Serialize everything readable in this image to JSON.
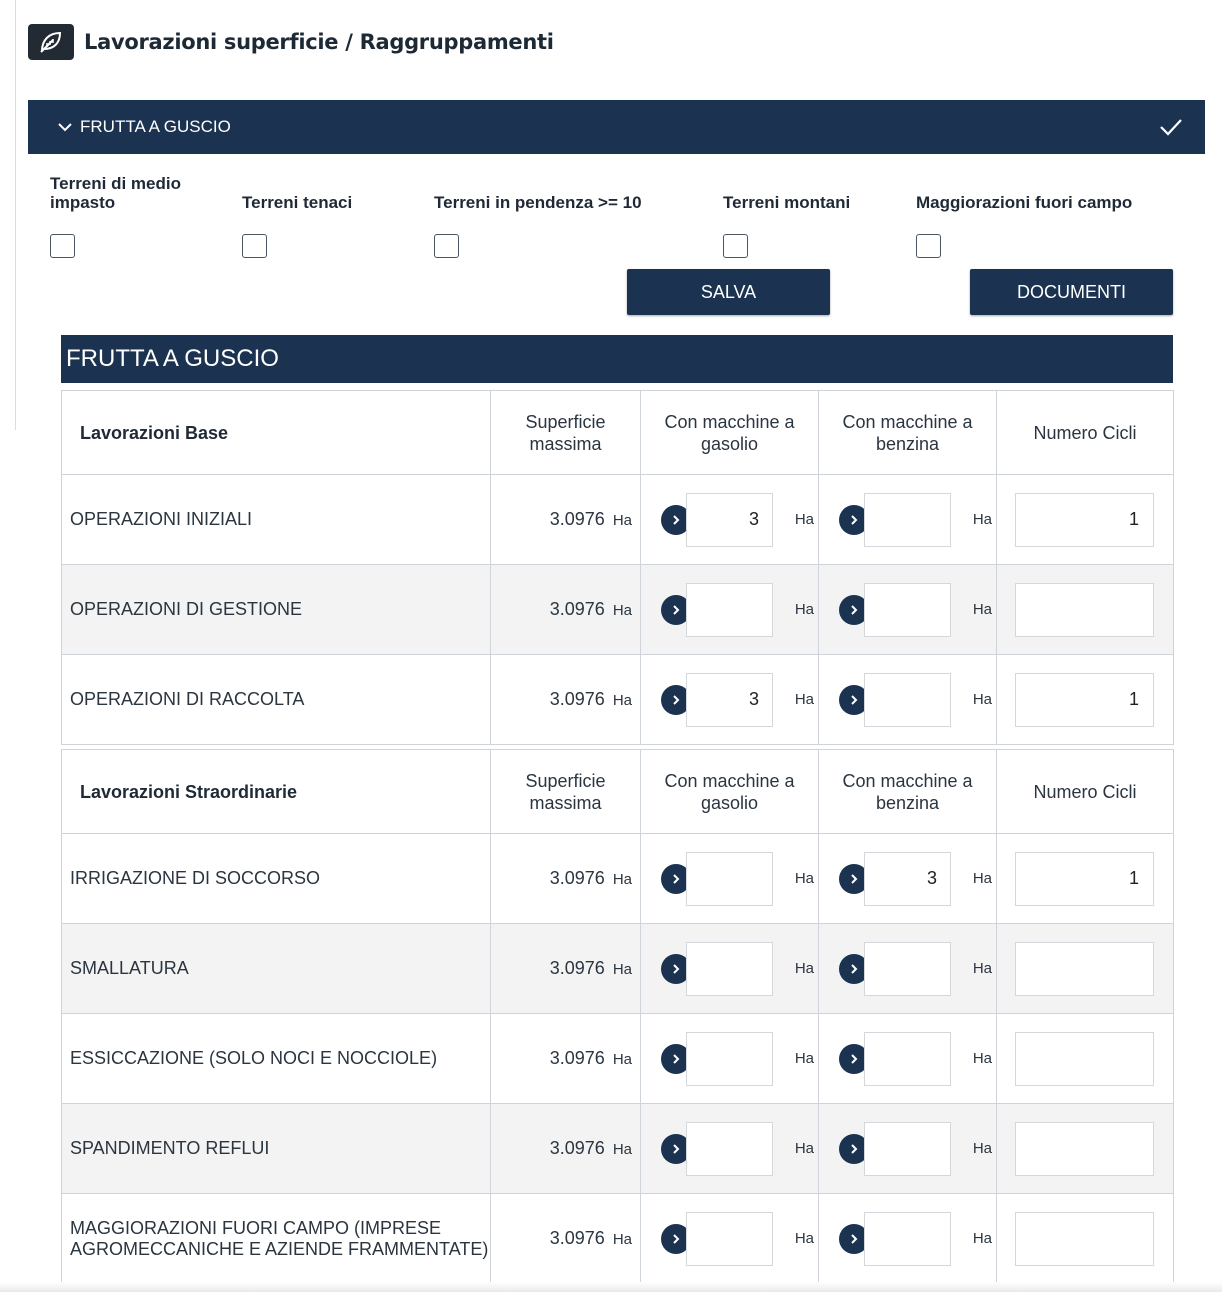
{
  "header": {
    "title": "Lavorazioni superficie / Raggruppamenti",
    "icon": "leaf-icon"
  },
  "accordion": {
    "label": "FRUTTA A GUSCIO",
    "expanded": true,
    "completed": true
  },
  "options": [
    {
      "label": "Terreni di medio impasto",
      "checked": false
    },
    {
      "label": "Terreni tenaci",
      "checked": false
    },
    {
      "label": "Terreni in pendenza >= 10",
      "checked": false
    },
    {
      "label": "Terreni montani",
      "checked": false
    },
    {
      "label": "Maggiorazioni fuori campo",
      "checked": false
    }
  ],
  "buttons": {
    "save": "SALVA",
    "documents": "DOCUMENTI"
  },
  "section": {
    "title": "FRUTTA A GUSCIO"
  },
  "columns": {
    "superficie": "Superficie massima",
    "gasolio": "Con macchine a gasolio",
    "benzina": "Con macchine a benzina",
    "cicli": "Numero Cicli",
    "unit": "Ha"
  },
  "base": {
    "title": "Lavorazioni Base",
    "rows": [
      {
        "name": "OPERAZIONI INIZIALI",
        "superficie": "3.0976",
        "gasolio": "3",
        "benzina": "",
        "cicli": "1"
      },
      {
        "name": "OPERAZIONI DI GESTIONE",
        "superficie": "3.0976",
        "gasolio": "",
        "benzina": "",
        "cicli": ""
      },
      {
        "name": "OPERAZIONI DI RACCOLTA",
        "superficie": "3.0976",
        "gasolio": "3",
        "benzina": "",
        "cicli": "1"
      }
    ]
  },
  "straordinarie": {
    "title": "Lavorazioni Straordinarie",
    "rows": [
      {
        "name": "IRRIGAZIONE DI SOCCORSO",
        "superficie": "3.0976",
        "gasolio": "",
        "benzina": "3",
        "cicli": "1"
      },
      {
        "name": "SMALLATURA",
        "superficie": "3.0976",
        "gasolio": "",
        "benzina": "",
        "cicli": ""
      },
      {
        "name": "ESSICCAZIONE (SOLO NOCI E NOCCIOLE)",
        "superficie": "3.0976",
        "gasolio": "",
        "benzina": "",
        "cicli": ""
      },
      {
        "name": "SPANDIMENTO REFLUI",
        "superficie": "3.0976",
        "gasolio": "",
        "benzina": "",
        "cicli": ""
      },
      {
        "name": "MAGGIORAZIONI FUORI CAMPO (IMPRESE AGROMECCANICHE E AZIENDE FRAMMENTATE)",
        "superficie": "3.0976",
        "gasolio": "",
        "benzina": "",
        "cicli": ""
      }
    ]
  },
  "colors": {
    "primary": "#1b3350",
    "row_alt": "#f3f3f3",
    "border": "#cfd4da"
  }
}
